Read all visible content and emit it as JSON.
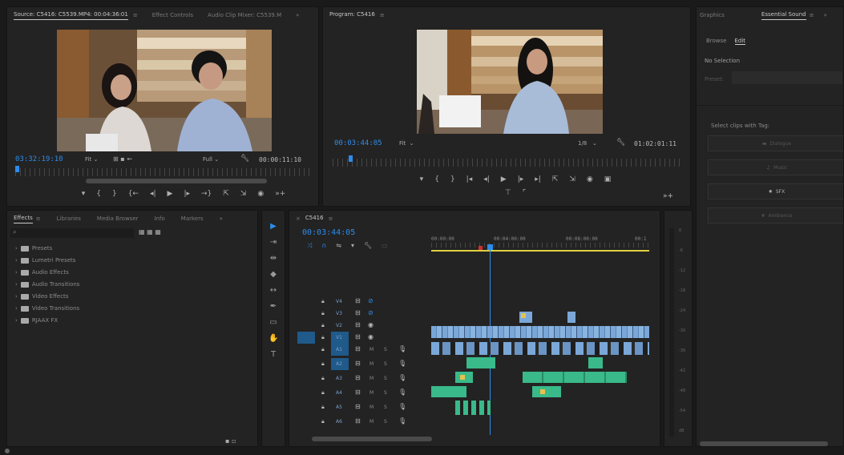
{
  "source_monitor": {
    "tabs": [
      "Source: C5416: C5539.MP4: 00:04:36:01",
      "Effect Controls",
      "Audio Clip Mixer: C5539.M",
      "»"
    ],
    "active_tab": "Source: C5416: C5539.MP4: 00:04:36:01",
    "menu_icon": "≡",
    "timecode": "03:32:19:10",
    "fit": "Fit",
    "quality": "Full",
    "duration": "00:00:11:10"
  },
  "program_monitor": {
    "title": "Program: C5416",
    "menu_icon": "≡",
    "timecode": "00:03:44:05",
    "fit": "Fit",
    "resolution": "1/8",
    "duration": "01:02:01:11"
  },
  "essential_sound": {
    "tabs": [
      "Graphics",
      "Essential Sound",
      "≡",
      "»"
    ],
    "subtabs": [
      "Browse",
      "Edit"
    ],
    "no_selection": "No Selection",
    "preset_label": "Preset:",
    "select_clips_label": "Select clips with Tag:",
    "buttons": [
      "Dialogue",
      "Music",
      "SFX",
      "Ambience"
    ]
  },
  "project_panel": {
    "tabs": [
      "Effects",
      "≡",
      "Libraries",
      "Media Browser",
      "Info",
      "Markers",
      "»"
    ],
    "search_placeholder": "",
    "bins": [
      "Presets",
      "Lumetri Presets",
      "Audio Effects",
      "Audio Transitions",
      "Video Effects",
      "Video Transitions",
      "RJAAX FX"
    ]
  },
  "timeline": {
    "sequence_name": "C5416",
    "menu_icon": "≡",
    "timecode": "00:03:44:05",
    "ruler_labels": [
      "00:00:00",
      "00:04:00:00",
      "00:08:00:00",
      "00:1"
    ],
    "video_tracks": [
      "V4",
      "V3",
      "V2",
      "V1"
    ],
    "audio_tracks": [
      "A1",
      "A2",
      "A3",
      "A4",
      "A5",
      "A6"
    ],
    "meter_scale": [
      "0",
      "-6",
      "-12",
      "-18",
      "-24",
      "-30",
      "-36",
      "-42",
      "-48",
      "-54",
      "dB"
    ]
  },
  "colors": {
    "accent": "#2d8ceb",
    "video_clip": "#7aa7d8",
    "audio_clip": "#3ab98a",
    "marker": "#e6c24a"
  }
}
